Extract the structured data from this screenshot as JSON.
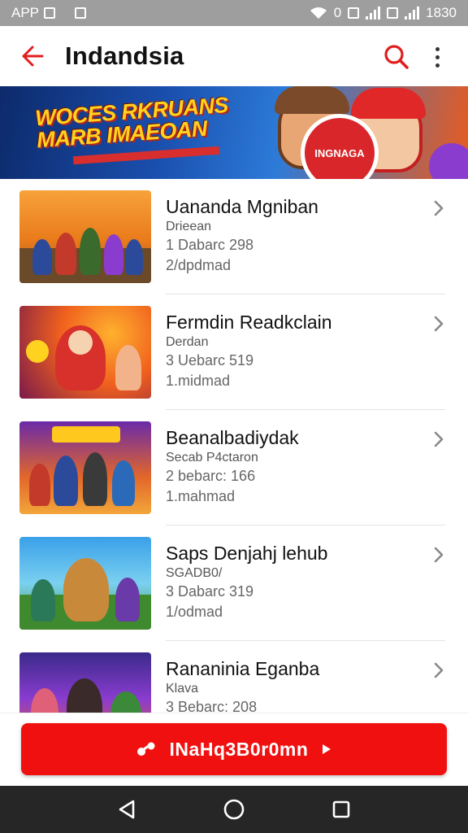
{
  "status_bar": {
    "carrier": "APP",
    "center": "0",
    "time": "1830"
  },
  "app_bar": {
    "title": "Indandsia"
  },
  "banner": {
    "line1": "WOCES RKRUANS",
    "line2": "MARB IMAEOAN",
    "badge": "INGNAGA"
  },
  "list": {
    "items": [
      {
        "title": "Uananda Mgniban",
        "subtitle": "Drieean",
        "meta1": "1 Dabarc 298",
        "meta2": "2/dpdmad"
      },
      {
        "title": "Fermdin Readkclain",
        "subtitle": "Derdan",
        "meta1": "3 Uebarc 519",
        "meta2": "1.midmad"
      },
      {
        "title": "Beanalbadiydak",
        "subtitle": "Secab P4ctaron",
        "meta1": "2 bebarc: 166",
        "meta2": "1.mahmad"
      },
      {
        "title": "Saps Denjahj lehub",
        "subtitle": "SGADB0/",
        "meta1": "3 Dabarc 319",
        "meta2": "1/odmad"
      },
      {
        "title": "Rananinia Eganba",
        "subtitle": "Klava",
        "meta1": "3 Bebarc: 208",
        "meta2": ""
      }
    ]
  },
  "cta": {
    "label": "INaHq3B0r0mn"
  },
  "colors": {
    "accent": "#f0100f",
    "nav_bar": "#262626",
    "status_bar": "#9e9e9e"
  }
}
